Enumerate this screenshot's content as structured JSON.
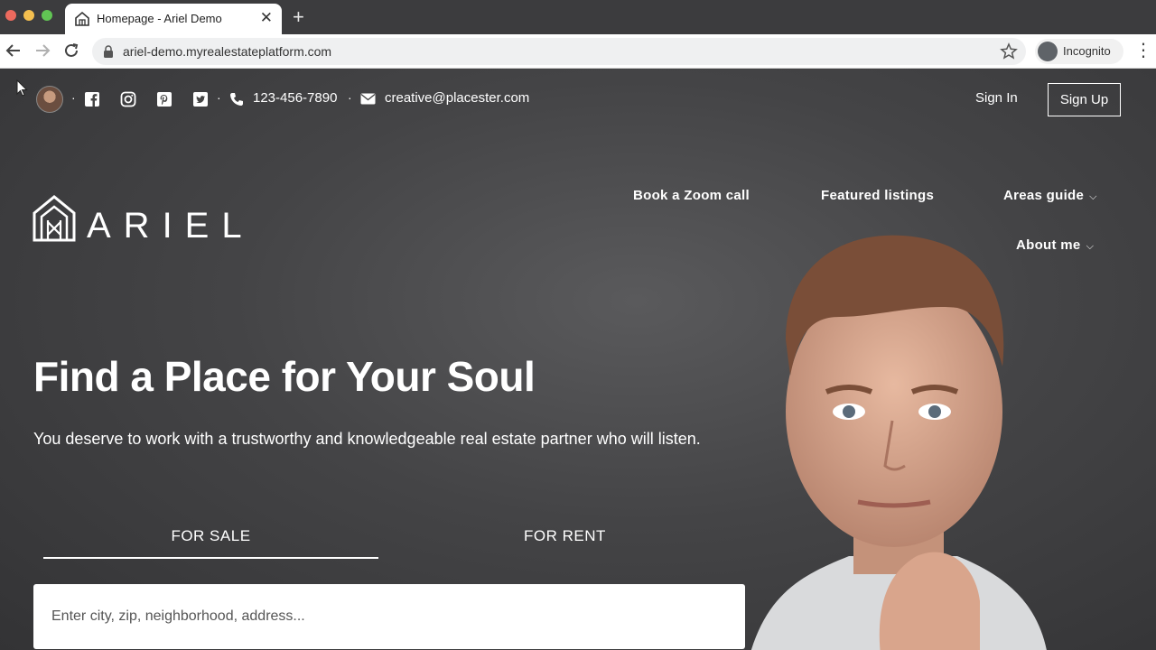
{
  "browser": {
    "tab_title": "Homepage - Ariel Demo",
    "tab_close": "✕",
    "new_tab": "+",
    "url": "ariel-demo.myrealestateplatform.com",
    "incognito_label": "Incognito",
    "icons": [
      "back-icon",
      "forward-icon",
      "reload-icon",
      "lock-icon",
      "star-icon",
      "incognito-icon",
      "menu-icon"
    ]
  },
  "topbar": {
    "separator": "·",
    "phone": "123-456-7890",
    "email": "creative@placester.com",
    "sign_in": "Sign In",
    "sign_up": "Sign Up",
    "social_icons": [
      "facebook-icon",
      "instagram-icon",
      "pinterest-icon",
      "twitter-icon"
    ]
  },
  "logo": {
    "word": "ARIEL"
  },
  "nav": {
    "zoom": "Book a Zoom call",
    "featured": "Featured listings",
    "areas": "Areas guide",
    "about": "About me",
    "chevron": "⌵"
  },
  "hero": {
    "headline": "Find a Place for Your Soul",
    "subline": "You deserve to work with a trustworthy and knowledgeable real estate partner who will listen."
  },
  "search": {
    "tab_sale": "FOR SALE",
    "tab_rent": "FOR RENT",
    "active_tab": "FOR SALE",
    "placeholder": "Enter city, zip, neighborhood, address..."
  },
  "colors": {
    "page_bg": "#444446",
    "text": "#ffffff",
    "search_bg": "#ffffff"
  }
}
